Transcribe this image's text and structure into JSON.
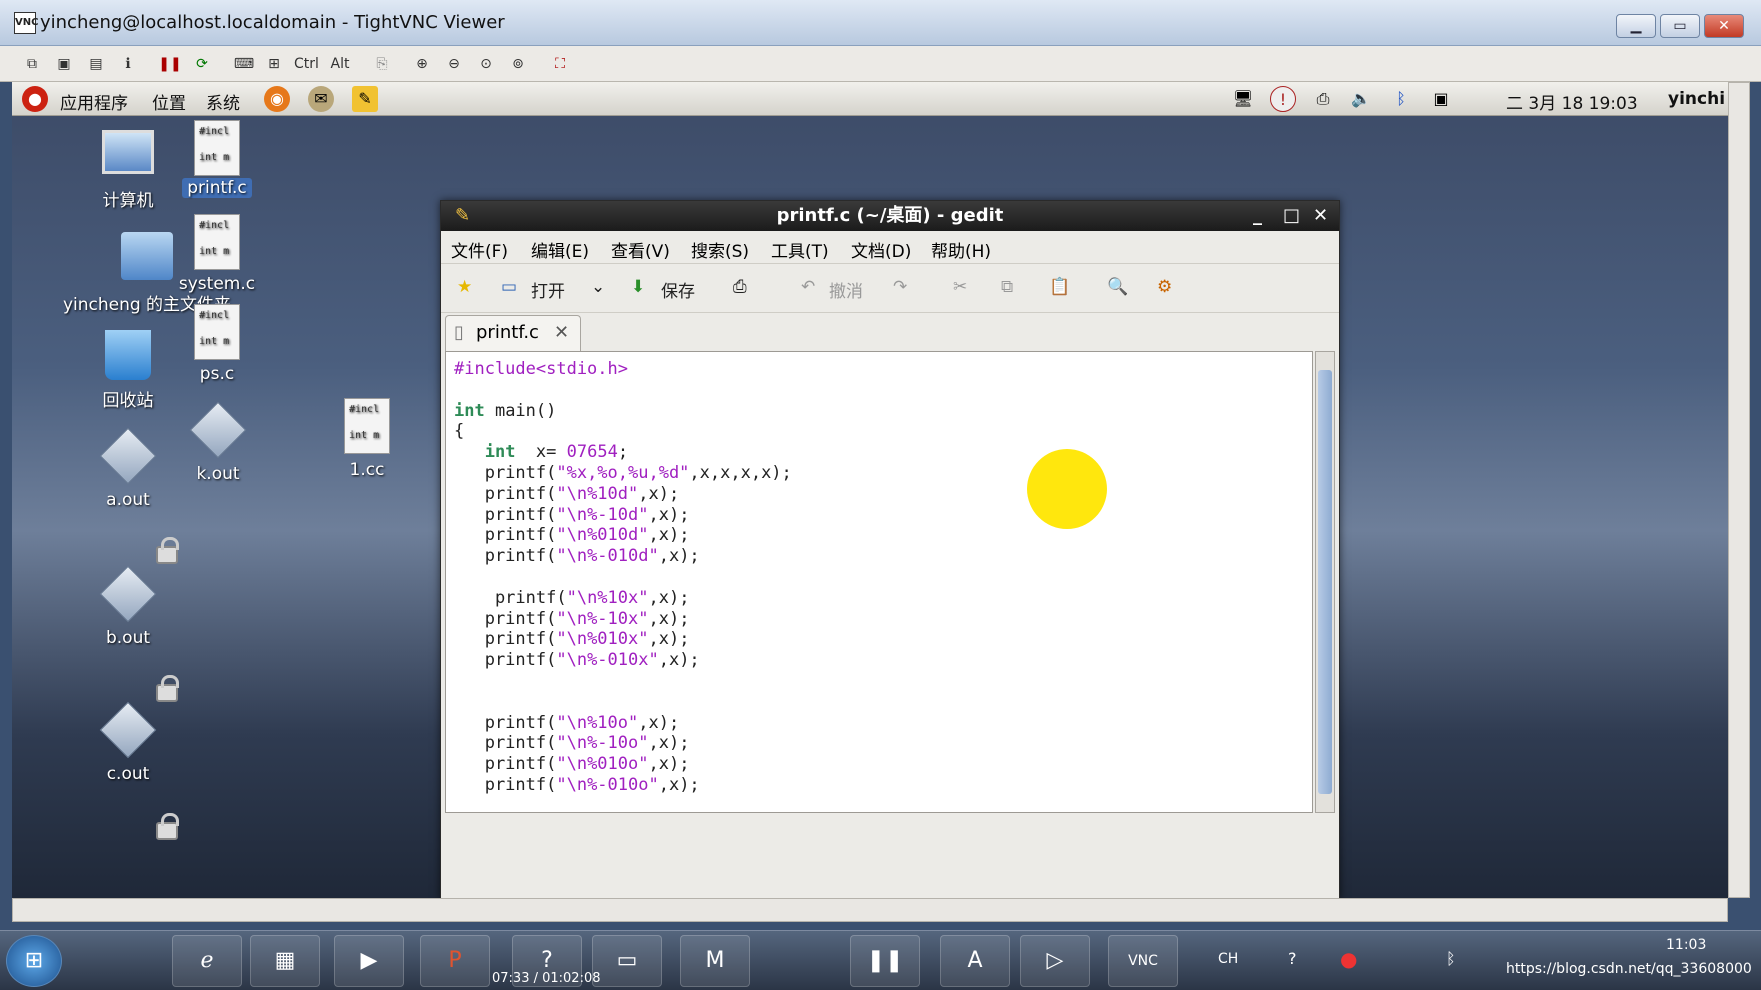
{
  "vnc": {
    "title": "yincheng@localhost.localdomain - TightVNC Viewer",
    "toolbar": {
      "ctrl": "Ctrl",
      "alt": "Alt"
    },
    "minimize": "▁",
    "maximize": "▭",
    "close": "✕"
  },
  "panel": {
    "menus": [
      "应用程序",
      "位置",
      "系统"
    ],
    "clock": "二 3月 18 19:03",
    "user": "yinchi"
  },
  "desktop_icons": [
    {
      "label": "计算机"
    },
    {
      "label": "printf.c",
      "preview1": "#incl",
      "preview2": "int m"
    },
    {
      "label": "system.c",
      "preview1": "#incl",
      "preview2": "int m"
    },
    {
      "label": "yincheng 的主文件夹"
    },
    {
      "label": "ps.c",
      "preview1": "#incl",
      "preview2": "int m"
    },
    {
      "label": "回收站"
    },
    {
      "label": "1.cc",
      "preview1": "#incl",
      "preview2": "int m"
    },
    {
      "label": "k.out"
    },
    {
      "label": "a.out"
    },
    {
      "label": "b.out"
    },
    {
      "label": "c.out"
    }
  ],
  "gedit": {
    "title": "printf.c (~/桌面) - gedit",
    "menus": [
      "文件(F)",
      "编辑(E)",
      "查看(V)",
      "搜索(S)",
      "工具(T)",
      "文档(D)",
      "帮助(H)"
    ],
    "toolbar": {
      "open": "打开",
      "save": "保存",
      "undo": "撤消"
    },
    "tab_label": "printf.c",
    "code": [
      "#include<stdio.h>",
      "",
      "int main()",
      "{",
      "   int  x= 07654;",
      "   printf(\"%x,%o,%u,%d\",x,x,x,x);",
      "   printf(\"\\n%10d\",x);",
      "   printf(\"\\n%-10d\",x);",
      "   printf(\"\\n%010d\",x);",
      "   printf(\"\\n%-010d\",x);",
      "",
      "    printf(\"\\n%10x\",x);",
      "   printf(\"\\n%-10x\",x);",
      "   printf(\"\\n%010x\",x);",
      "   printf(\"\\n%-010x\",x);",
      "",
      "",
      "   printf(\"\\n%10o\",x);",
      "   printf(\"\\n%-10o\",x);",
      "   printf(\"\\n%010o\",x);",
      "   printf(\"\\n%-010o\",x);"
    ]
  },
  "taskbar": {
    "video_time": "07:33 / 01:02:08",
    "clock": "11:03",
    "lang": "CH",
    "watermark": "https://blog.csdn.net/qq_33608000"
  }
}
